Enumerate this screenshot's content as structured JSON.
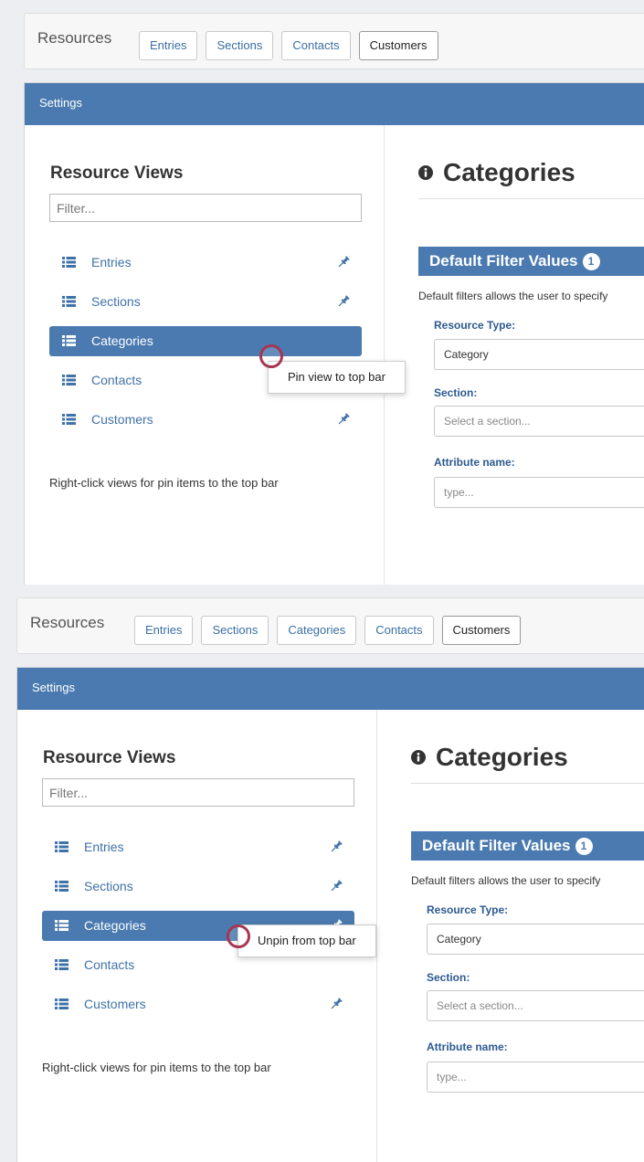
{
  "colors": {
    "accent": "#4a7ab0",
    "link": "#3f72a8",
    "cursor_ring": "#a83552"
  },
  "shots": [
    {
      "resources_label": "Resources",
      "pills": [
        "Entries",
        "Sections",
        "Contacts",
        "Customers"
      ],
      "settings_header": "Settings",
      "resource_views_title": "Resource Views",
      "filter_placeholder": "Filter...",
      "views": [
        {
          "label": "Entries",
          "pinned": true
        },
        {
          "label": "Sections",
          "pinned": true
        },
        {
          "label": "Categories",
          "pinned": false,
          "active": true
        },
        {
          "label": "Contacts",
          "pinned": false
        },
        {
          "label": "Customers",
          "pinned": true
        }
      ],
      "hint": "Right-click views for pin items to the top bar",
      "heading": "Categories",
      "dfv_title": "Default Filter Values",
      "dfv_badge": "1",
      "dfv_desc": "Default filters allows the user to specify",
      "fields": [
        {
          "label": "Resource Type:",
          "value": "Category",
          "placeholder": false
        },
        {
          "label": "Section:",
          "value": "Select a section...",
          "placeholder": true
        },
        {
          "label": "Attribute name:",
          "value": "type...",
          "placeholder": true
        }
      ],
      "context_menu": "Pin view to top bar"
    },
    {
      "resources_label": "Resources",
      "pills": [
        "Entries",
        "Sections",
        "Categories",
        "Contacts",
        "Customers"
      ],
      "settings_header": "Settings",
      "resource_views_title": "Resource Views",
      "filter_placeholder": "Filter...",
      "views": [
        {
          "label": "Entries",
          "pinned": true
        },
        {
          "label": "Sections",
          "pinned": true
        },
        {
          "label": "Categories",
          "pinned": true,
          "active": true
        },
        {
          "label": "Contacts",
          "pinned": false
        },
        {
          "label": "Customers",
          "pinned": true
        }
      ],
      "hint": "Right-click views for pin items to the top bar",
      "heading": "Categories",
      "dfv_title": "Default Filter Values",
      "dfv_badge": "1",
      "dfv_desc": "Default filters allows the user to specify",
      "fields": [
        {
          "label": "Resource Type:",
          "value": "Category",
          "placeholder": false
        },
        {
          "label": "Section:",
          "value": "Select a section...",
          "placeholder": true
        },
        {
          "label": "Attribute name:",
          "value": "type...",
          "placeholder": true
        }
      ],
      "context_menu": "Unpin from top bar"
    }
  ]
}
